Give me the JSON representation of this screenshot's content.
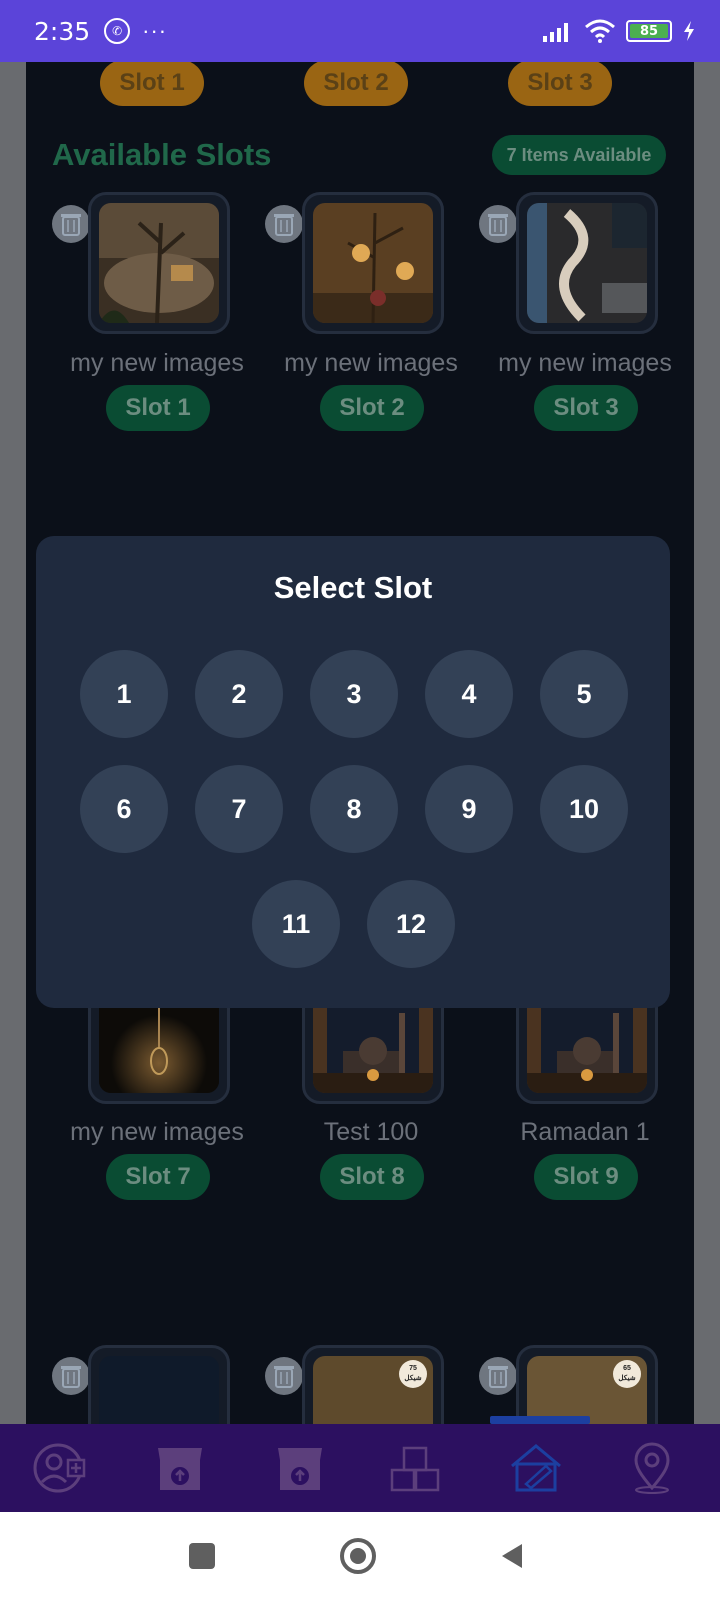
{
  "status_bar": {
    "time": "2:35",
    "dots": "···",
    "battery": "85",
    "icons": [
      "whatsapp-icon",
      "signal-icon",
      "wifi-icon",
      "battery-icon",
      "charging-icon"
    ]
  },
  "top_slots": [
    "Slot 1",
    "Slot 2",
    "Slot 3"
  ],
  "section": {
    "title": "Available Slots",
    "badge": "7 Items Available"
  },
  "row1": [
    {
      "name": "my new images",
      "slot": "Slot 1"
    },
    {
      "name": "my new images",
      "slot": "Slot 2"
    },
    {
      "name": "my new images",
      "slot": "Slot 3"
    }
  ],
  "row3": [
    {
      "name": "my new images",
      "slot": "Slot 7"
    },
    {
      "name": "Test 100",
      "slot": "Slot 8"
    },
    {
      "name": "Ramadan 1",
      "slot": "Slot 9"
    }
  ],
  "row4_price_tags": [
    "75\nشيكل",
    "65\nشيكل"
  ],
  "modal": {
    "title": "Select Slot",
    "slots": [
      "1",
      "2",
      "3",
      "4",
      "5",
      "6",
      "7",
      "8",
      "9",
      "10",
      "11",
      "12"
    ]
  },
  "colors": {
    "status_bar": "#5b44d9",
    "bottom_bar": "#2c1060",
    "slot_pill": "#0a4c33",
    "top_pill": "#9a6513",
    "modal_bg": "#1f2a3e",
    "slot_button": "#334156"
  },
  "bottom_nav": [
    "add-user-icon",
    "store-upload-icon",
    "store-upload-icon-2",
    "boxes-icon",
    "house-edit-icon",
    "location-pin-icon"
  ],
  "system_nav": [
    "recents-icon",
    "home-icon",
    "back-icon"
  ]
}
